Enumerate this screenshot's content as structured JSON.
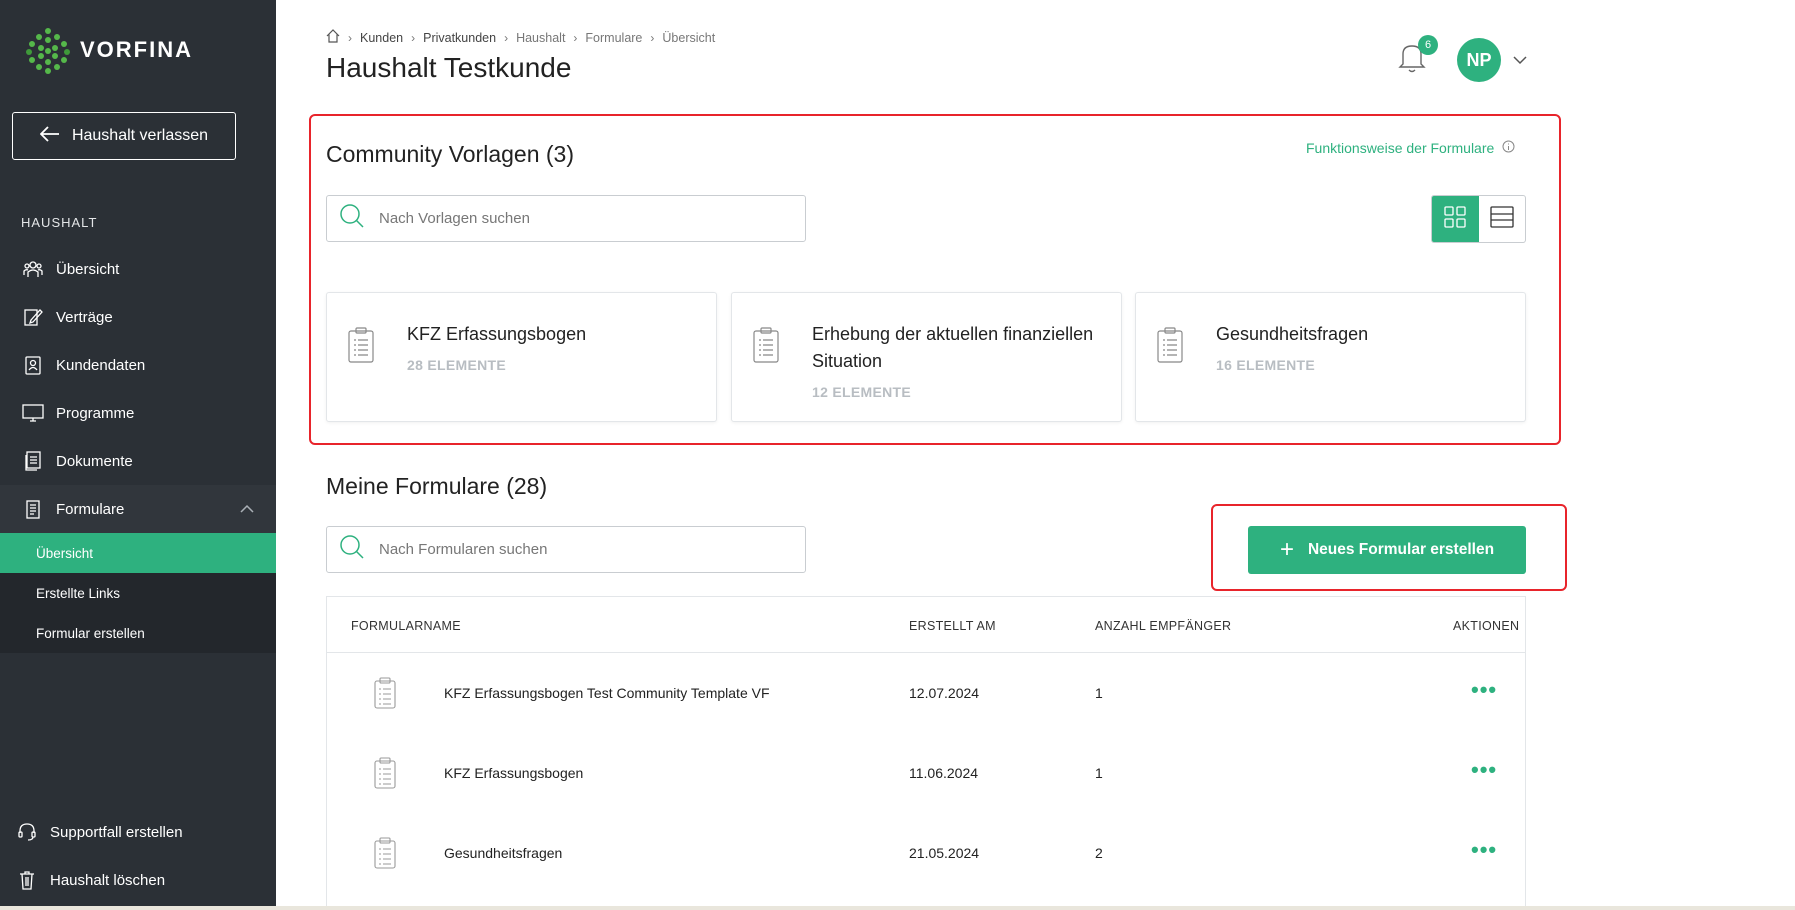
{
  "brand": {
    "name": "VORFINA"
  },
  "sidebar": {
    "leave_button": "Haushalt verlassen",
    "section_label": "HAUSHALT",
    "items": [
      {
        "label": "Übersicht",
        "icon": "people-icon"
      },
      {
        "label": "Verträge",
        "icon": "edit-icon"
      },
      {
        "label": "Kundendaten",
        "icon": "contact-card-icon"
      },
      {
        "label": "Programme",
        "icon": "monitor-icon"
      },
      {
        "label": "Dokumente",
        "icon": "documents-icon"
      }
    ],
    "open_item": {
      "label": "Formulare",
      "icon": "form-icon"
    },
    "sub_items": [
      "Übersicht",
      "Erstellte Links",
      "Formular erstellen"
    ],
    "bottom_items": [
      {
        "label": "Supportfall erstellen",
        "icon": "headset-icon"
      },
      {
        "label": "Haushalt löschen",
        "icon": "trash-icon"
      }
    ]
  },
  "header": {
    "breadcrumb": [
      "Kunden",
      "Privatkunden",
      "Haushalt",
      "Formulare",
      "Übersicht"
    ],
    "title": "Haushalt Testkunde",
    "notifications_count": "6",
    "user_initials": "NP"
  },
  "community": {
    "title": "Community Vorlagen (3)",
    "help_link": "Funktionsweise der Formulare",
    "search_placeholder": "Nach Vorlagen suchen",
    "templates": [
      {
        "name": "KFZ Erfassungsbogen",
        "count": "28 ELEMENTE"
      },
      {
        "name": "Erhebung der aktuellen finanziellen Situation",
        "count": "12 ELEMENTE"
      },
      {
        "name": "Gesundheitsfragen",
        "count": "16 ELEMENTE"
      }
    ]
  },
  "my_forms": {
    "title": "Meine Formulare (28)",
    "search_placeholder": "Nach Formularen suchen",
    "new_button": "Neues Formular erstellen",
    "columns": [
      "FORMULARNAME",
      "ERSTELLT AM",
      "ANZAHL EMPFÄNGER",
      "AKTIONEN"
    ],
    "rows": [
      {
        "name": "KFZ Erfassungsbogen Test Community Template VF",
        "created": "12.07.2024",
        "recipients": "1"
      },
      {
        "name": "KFZ Erfassungsbogen",
        "created": "11.06.2024",
        "recipients": "1"
      },
      {
        "name": "Gesundheitsfragen",
        "created": "21.05.2024",
        "recipients": "2"
      }
    ],
    "actions_label": "•••"
  },
  "colors": {
    "accent": "#2eb17f",
    "sidebar": "#2b3036",
    "highlight": "#e8242b"
  }
}
